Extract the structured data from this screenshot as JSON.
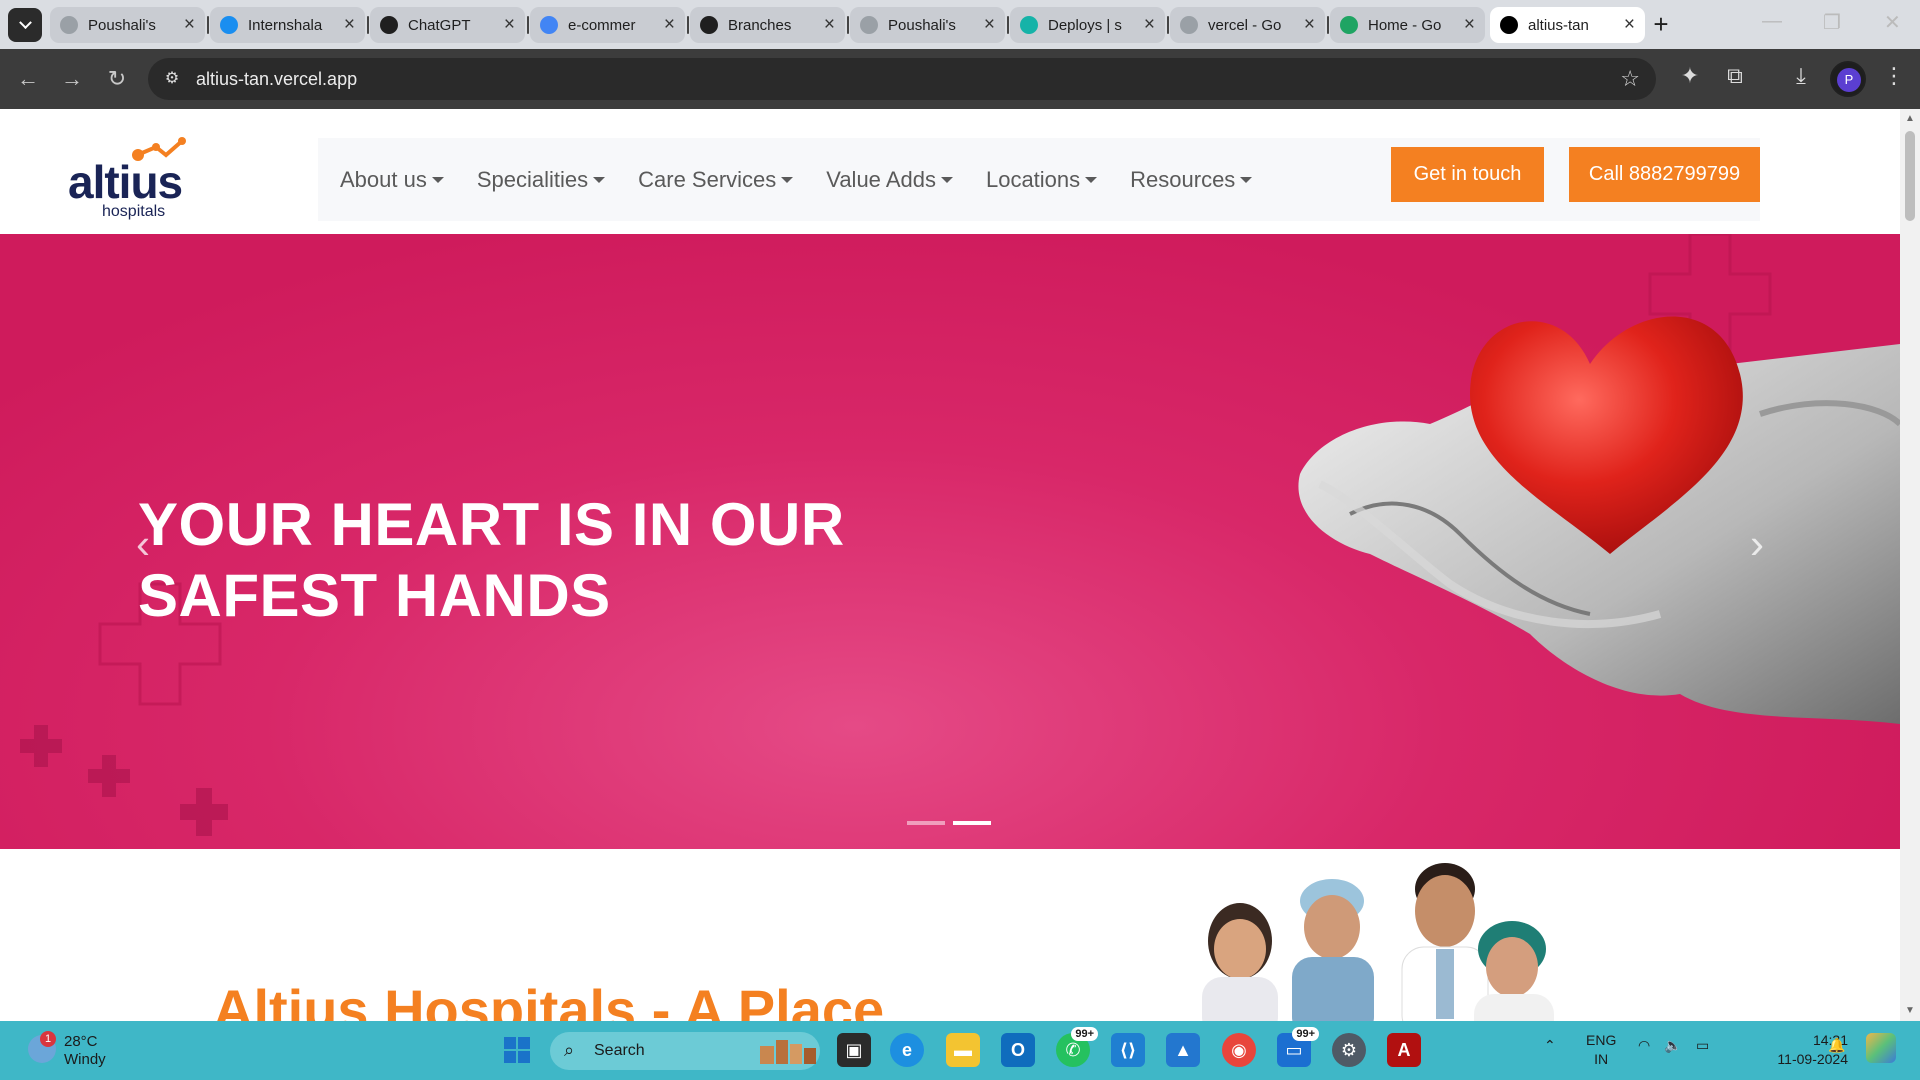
{
  "browser": {
    "tabs": [
      {
        "title": "Poushali's",
        "favicon": "globe-icon",
        "color": "#9aa0a6"
      },
      {
        "title": "Internshala",
        "favicon": "internshala-icon",
        "color": "#1a8ef0"
      },
      {
        "title": "ChatGPT",
        "favicon": "chatgpt-icon",
        "color": "#1f1f1f"
      },
      {
        "title": "e-commer",
        "favicon": "google-icon",
        "color": "#4285f4"
      },
      {
        "title": "Branches",
        "favicon": "github-icon",
        "color": "#1f1f1f"
      },
      {
        "title": "Poushali's",
        "favicon": "globe-icon",
        "color": "#9aa0a6"
      },
      {
        "title": "Deploys | s",
        "favicon": "netlify-icon",
        "color": "#16b3a8"
      },
      {
        "title": "vercel - Go",
        "favicon": "globe-icon",
        "color": "#9aa0a6"
      },
      {
        "title": "Home - Go",
        "favicon": "google-drive-icon",
        "color": "#1fa463"
      },
      {
        "title": "altius-tan",
        "favicon": "vercel-icon",
        "color": "#000000"
      }
    ],
    "active_tab": 9,
    "url": "altius-tan.vercel.app",
    "profile_initial": "P"
  },
  "site": {
    "logo_word": "altius",
    "logo_sub": "hospitals",
    "nav": [
      {
        "label": "About us"
      },
      {
        "label": "Specialities"
      },
      {
        "label": "Care Services"
      },
      {
        "label": "Value Adds"
      },
      {
        "label": "Locations"
      },
      {
        "label": "Resources"
      }
    ],
    "cta_contact": "Get in touch",
    "cta_call": "Call 8882799799",
    "accent": "#f48021",
    "brand": "#1a2456",
    "hero": {
      "title_line1": "YOUR HEART IS IN OUR",
      "title_line2": "SAFEST HANDS",
      "bg": "#d8246a",
      "slide_count": 2,
      "active_slide": 2
    },
    "section_heading": "Altius Hospitals - A Place"
  },
  "taskbar": {
    "weather_temp": "28°C",
    "weather_cond": "Windy",
    "weather_badge": "1",
    "search_placeholder": "Search",
    "badge_whatsapp": "99+",
    "badge_teams": "99+",
    "lang_line1": "ENG",
    "lang_line2": "IN",
    "time": "14:31",
    "date": "11-09-2024"
  }
}
